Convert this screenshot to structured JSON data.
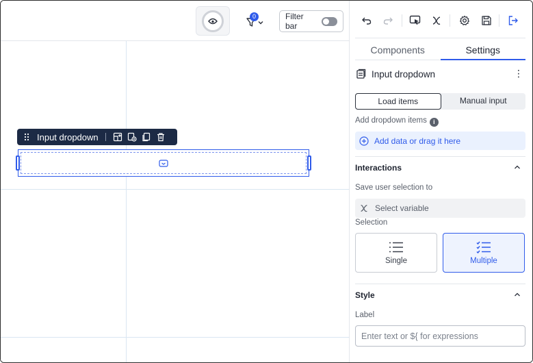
{
  "canvas": {
    "filter_count": "0",
    "filter_bar_label": "Filter bar",
    "component_toolbar_label": "Input dropdown"
  },
  "panel": {
    "tabs": [
      {
        "label": "Components",
        "active": false
      },
      {
        "label": "Settings",
        "active": true
      }
    ],
    "component_title": "Input dropdown",
    "kebab_glyph": "⋮",
    "source_toggle": {
      "options": [
        "Load items",
        "Manual input"
      ],
      "selected": "Load items"
    },
    "add_items_label": "Add dropdown items",
    "info_glyph": "i",
    "add_data_label": "Add data or drag it here",
    "interactions": {
      "title": "Interactions",
      "save_selection_label": "Save user selection to",
      "select_variable_label": "Select variable",
      "selection_label": "Selection",
      "selection_options": [
        {
          "label": "Single",
          "icon": "list-icon",
          "active": false
        },
        {
          "label": "Multiple",
          "icon": "checklist-icon",
          "active": true
        }
      ]
    },
    "style": {
      "title": "Style",
      "label_field_label": "Label",
      "label_field_placeholder": "Enter text or ${ for expressions",
      "label_field_value": ""
    }
  },
  "colors": {
    "accent": "#2f5bea",
    "toolbar_dark": "#1c2a45",
    "grid_line": "#d9e6f2"
  }
}
